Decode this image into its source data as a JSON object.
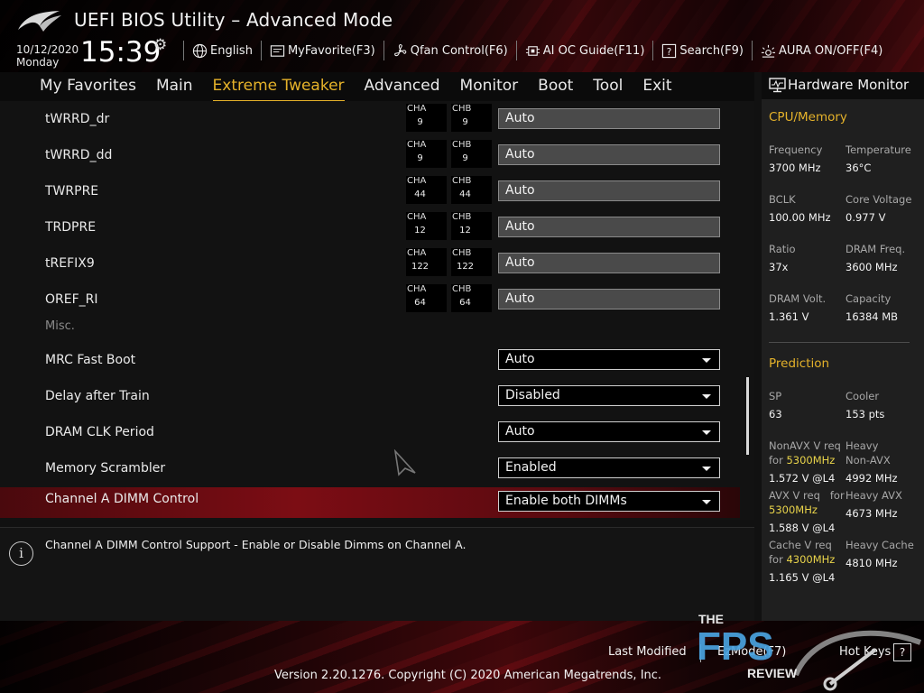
{
  "header": {
    "title": "UEFI BIOS Utility – Advanced Mode",
    "date": "10/12/2020",
    "day": "Monday",
    "time": "15:39",
    "toolbar": [
      {
        "label": "English",
        "icon": "globe-icon"
      },
      {
        "label": "MyFavorite(F3)",
        "icon": "favorite-icon"
      },
      {
        "label": "Qfan Control(F6)",
        "icon": "fan-icon"
      },
      {
        "label": "AI OC Guide(F11)",
        "icon": "chip-icon"
      },
      {
        "label": "Search(F9)",
        "icon": "search-help-icon"
      },
      {
        "label": "AURA ON/OFF(F4)",
        "icon": "aura-icon"
      }
    ]
  },
  "nav": {
    "tabs": [
      "My Favorites",
      "Main",
      "Extreme Tweaker",
      "Advanced",
      "Monitor",
      "Boot",
      "Tool",
      "Exit"
    ],
    "active": "Extreme Tweaker"
  },
  "settings": {
    "rows": [
      {
        "label": "tWRRD_dr",
        "cha": "9",
        "chb": "9",
        "value": "Auto"
      },
      {
        "label": "tWRRD_dd",
        "cha": "9",
        "chb": "9",
        "value": "Auto"
      },
      {
        "label": "TWRPRE",
        "cha": "44",
        "chb": "44",
        "value": "Auto"
      },
      {
        "label": "TRDPRE",
        "cha": "12",
        "chb": "12",
        "value": "Auto"
      },
      {
        "label": "tREFIX9",
        "cha": "122",
        "chb": "122",
        "value": "Auto"
      },
      {
        "label": "OREF_RI",
        "cha": "64",
        "chb": "64",
        "value": "Auto"
      }
    ],
    "cha_label": "CHA",
    "chb_label": "CHB",
    "misc_label": "Misc.",
    "dropdowns": [
      {
        "label": "MRC Fast Boot",
        "value": "Auto"
      },
      {
        "label": "Delay after Train",
        "value": "Disabled"
      },
      {
        "label": "DRAM CLK Period",
        "value": "Auto"
      },
      {
        "label": "Memory Scrambler",
        "value": "Enabled"
      },
      {
        "label": "Channel A DIMM Control",
        "value": "Enable both DIMMs"
      }
    ]
  },
  "help": {
    "icon": "info-icon",
    "text": "Channel A DIMM Control Support - Enable or Disable Dimms on Channel A."
  },
  "hardware_monitor": {
    "title": "Hardware Monitor",
    "cpu_section": "CPU/Memory",
    "frequency_label": "Frequency",
    "frequency": "3700 MHz",
    "temperature_label": "Temperature",
    "temperature": "36°C",
    "bclk_label": "BCLK",
    "bclk": "100.00 MHz",
    "core_voltage_label": "Core Voltage",
    "core_voltage": "0.977 V",
    "ratio_label": "Ratio",
    "ratio": "37x",
    "dram_freq_label": "DRAM Freq.",
    "dram_freq": "3600 MHz",
    "dram_volt_label": "DRAM Volt.",
    "dram_volt": "1.361 V",
    "capacity_label": "Capacity",
    "capacity": "16384 MB",
    "prediction_section": "Prediction",
    "sp_label": "SP",
    "sp": "63",
    "cooler_label": "Cooler",
    "cooler": "153 pts",
    "nonavx_req_label": "NonAVX V req",
    "for_label": "for",
    "nonavx_freq": "5300MHz",
    "nonavx_req": "1.572 V @L4",
    "heavy_label": "Heavy",
    "nonavx_label": "Non-AVX",
    "heavy_nonavx": "4992 MHz",
    "avx_req_label": "AVX V req",
    "avx_freq": "5300MHz",
    "avx_req": "1.588 V @L4",
    "heavy_avx_label": "Heavy AVX",
    "heavy_avx": "4673 MHz",
    "cache_req_label": "Cache V req",
    "cache_freq": "4300MHz",
    "cache_req": "1.165 V @L4",
    "heavy_cache_label": "Heavy Cache",
    "heavy_cache": "4810 MHz"
  },
  "footer": {
    "last_modified": "Last Modified",
    "ezmode": "EzMode(F7)",
    "hotkeys": "Hot Keys",
    "hotkeys_key": "?",
    "copyright": "Version 2.20.1276. Copyright (C) 2020 American Megatrends, Inc."
  },
  "watermark": {
    "line1": "THE",
    "line2": "FPS",
    "line3": "REVIEW"
  },
  "colors": {
    "accent": "#e5b22a",
    "selected_row": "#7c0d14",
    "highlight": "#e8d34a"
  }
}
